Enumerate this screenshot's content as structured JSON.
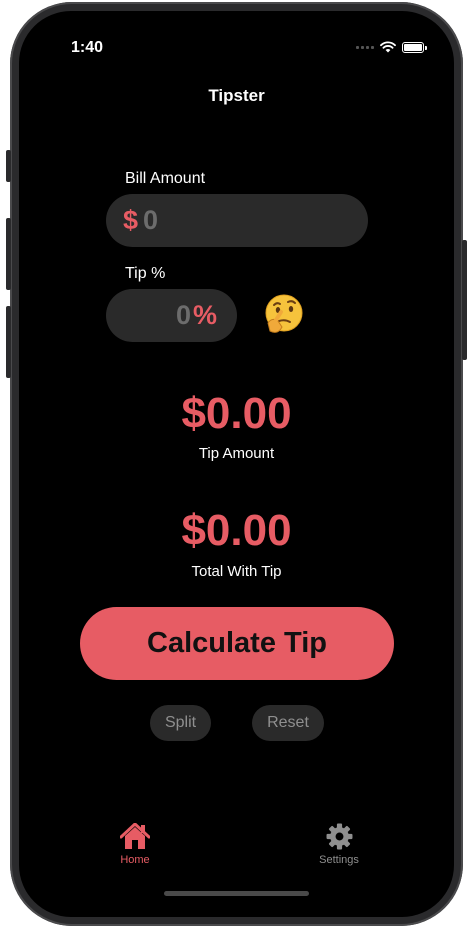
{
  "status_bar": {
    "time": "1:40"
  },
  "nav": {
    "title": "Tipster"
  },
  "bill": {
    "label": "Bill Amount",
    "currency_symbol": "$",
    "value": "0"
  },
  "tip": {
    "label": "Tip %",
    "value": "0",
    "percent_symbol": "%"
  },
  "results": {
    "tip_amount": "$0.00",
    "tip_amount_label": "Tip Amount",
    "total": "$0.00",
    "total_label": "Total With Tip"
  },
  "actions": {
    "calculate_label": "Calculate Tip",
    "split_label": "Split",
    "reset_label": "Reset"
  },
  "tabs": [
    {
      "label": "Home",
      "icon": "home-icon",
      "selected": true
    },
    {
      "label": "Settings",
      "icon": "gear-icon",
      "selected": false
    }
  ],
  "colors": {
    "accent": "#e75c64",
    "background": "#000000",
    "field": "#2a2a2a",
    "inactive": "#8f8f8f"
  }
}
